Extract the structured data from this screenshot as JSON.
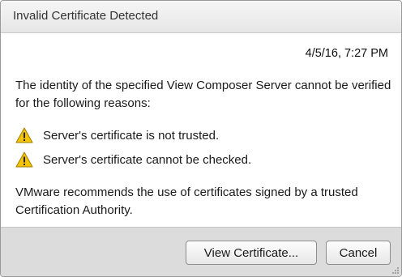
{
  "dialog": {
    "title": "Invalid Certificate Detected",
    "timestamp": "4/5/16, 7:27 PM",
    "message": "The identity of the specified View Composer Server cannot be verified for the following reasons:",
    "reasons": [
      {
        "icon": "warning-icon",
        "text": "Server's certificate is not trusted."
      },
      {
        "icon": "warning-icon",
        "text": "Server's certificate cannot be checked."
      }
    ],
    "recommendation": "VMware recommends the use of certificates signed by a trusted Certification Authority.",
    "buttons": {
      "view_certificate": "View Certificate...",
      "cancel": "Cancel"
    }
  },
  "colors": {
    "warning": "#f5c400",
    "footer_bg": "#dcdcdc",
    "title_bg": "#ececec"
  }
}
